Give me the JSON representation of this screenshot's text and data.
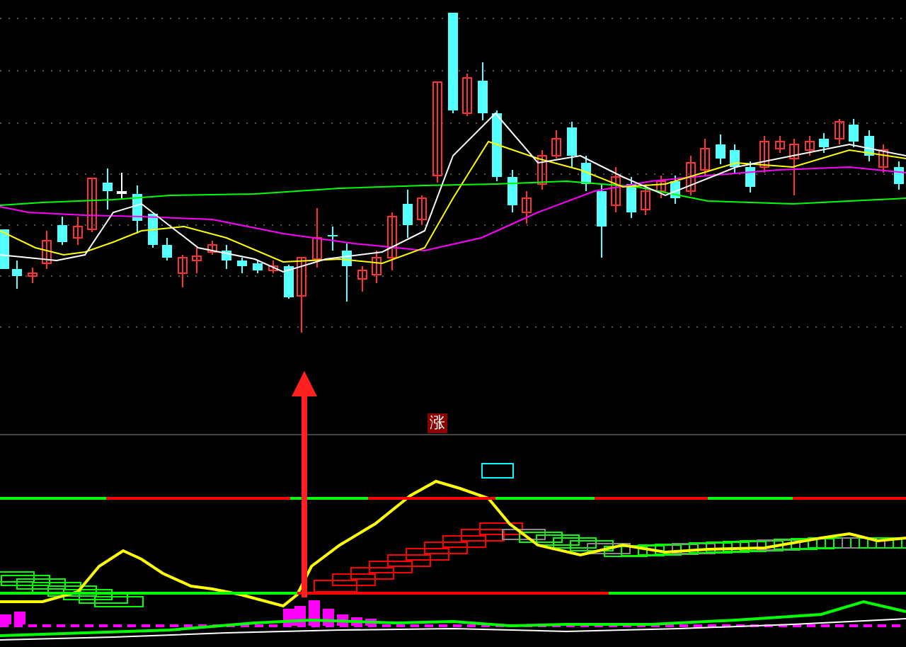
{
  "signal_label": {
    "text": "涨"
  }
}
